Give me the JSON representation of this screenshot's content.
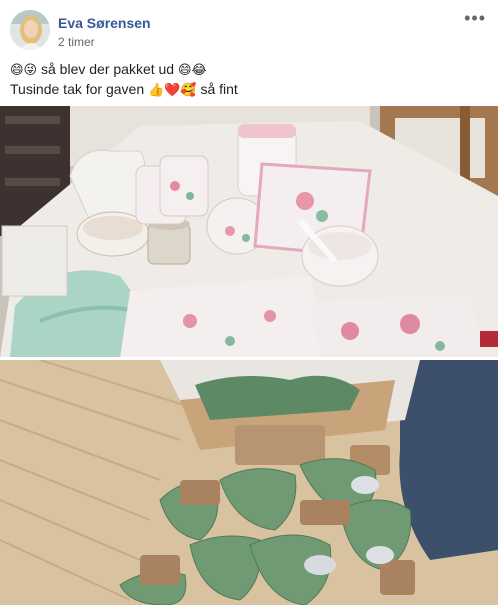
{
  "post": {
    "author": "Eva Sørensen",
    "timestamp": "2 timer",
    "more_label": "•••",
    "line1_emoji_start": "😄😜",
    "line1_text": " så blev der pakket ud ",
    "line1_emoji_end": "😄😂",
    "line2_text": "Tusinde tak for gaven ",
    "line2_emoji": "👍❤️🥰",
    "line2_text_end": " så fint"
  },
  "colors": {
    "author_link": "#365899",
    "meta_text": "#616770",
    "body_text": "#1d2129"
  },
  "photos": [
    {
      "subject": "table with floral crockery, jugs, mugs, bowls, napkins and textiles"
    },
    {
      "subject": "opened cardboard box with green wrapping paper on wooden floor"
    }
  ]
}
